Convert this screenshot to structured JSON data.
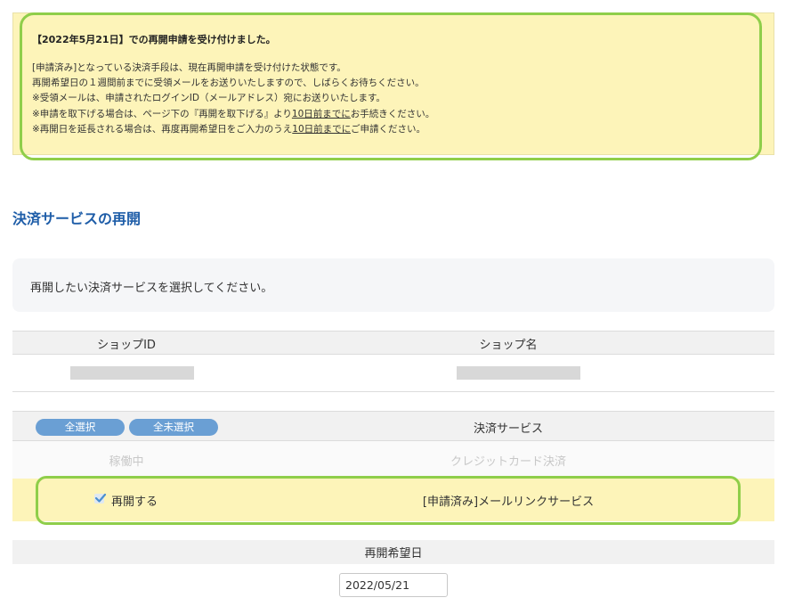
{
  "notice": {
    "title": "【2022年5月21日】での再開申請を受け付けました。",
    "line1": "[申請済み]となっている決済手段は、現在再開申請を受け付けた状態です。",
    "line2": "再開希望日の１週間前までに受領メールをお送りいたしますので、しばらくお待ちください。",
    "line3": "※受領メールは、申請されたログインID（メールアドレス）宛にお送りいたします。",
    "line4_a": "※申請を取下げる場合は、ページ下の『再開を取下げる』より",
    "line4_u": "10日前までに",
    "line4_b": "お手続きください。",
    "line5_a": "※再開日を延長される場合は、再度再開希望日をご入力のうえ",
    "line5_u": "10日前までに",
    "line5_b": "ご申請ください。"
  },
  "section_title": "決済サービスの再開",
  "info_text": "再開したい決済サービスを選択してください。",
  "shop_table": {
    "col_shop_id": "ショップID",
    "col_shop_name": "ショップ名"
  },
  "service_table": {
    "select_all": "全選択",
    "deselect_all": "全未選択",
    "col_service": "決済サービス",
    "row1_status": "稼働中",
    "row1_service": "クレジットカード決済",
    "row2_checkbox_label": "再開する",
    "row2_checked": true,
    "row2_service": "[申請済み]メールリンクサービス"
  },
  "resume_date": {
    "label": "再開希望日",
    "value": "2022/05/21"
  },
  "colors": {
    "notice_bg": "#fdf4b9",
    "highlight_ring": "#8fce4a",
    "title_blue": "#1e5da8",
    "pill_blue": "#6a9fd4"
  }
}
